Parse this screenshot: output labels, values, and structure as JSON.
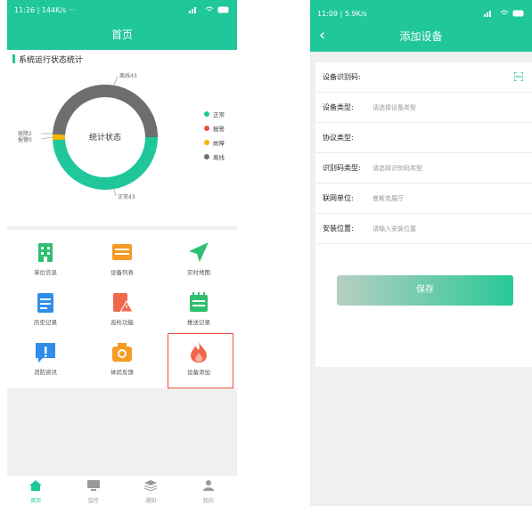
{
  "left": {
    "status": {
      "time": "11:26",
      "speed": "144K/s",
      "dots": "···"
    },
    "title": "首页",
    "stats": {
      "title": "系统运行状态统计",
      "center_label": "统计状态",
      "callouts": {
        "offline": "离线43",
        "normal": "正常43",
        "fault": "故障2",
        "alarm": "报警0"
      },
      "legend": [
        {
          "label": "正常",
          "color": "#1fc79a"
        },
        {
          "label": "报警",
          "color": "#e8523c"
        },
        {
          "label": "故障",
          "color": "#f5b800"
        },
        {
          "label": "离线",
          "color": "#6e6e6e"
        }
      ]
    },
    "grid": [
      {
        "label": "单位信息",
        "icon": "building-icon",
        "color": "#2fbf71"
      },
      {
        "label": "设备列表",
        "icon": "list-icon",
        "color": "#f59a23"
      },
      {
        "label": "实时地图",
        "icon": "send-icon",
        "color": "#2fbf71"
      },
      {
        "label": "历史记录",
        "icon": "clipboard-icon",
        "color": "#2f8fe8"
      },
      {
        "label": "巡检功能",
        "icon": "inspect-icon",
        "color": "#f0674a"
      },
      {
        "label": "推送记录",
        "icon": "calendar-icon",
        "color": "#2fbf71"
      },
      {
        "label": "消防资讯",
        "icon": "alert-message-icon",
        "color": "#2f8fe8"
      },
      {
        "label": "体验反馈",
        "icon": "camera-icon",
        "color": "#f59a23"
      },
      {
        "label": "设备添加",
        "icon": "flame-icon",
        "color": "#f0674a"
      }
    ],
    "tabs": [
      {
        "label": "首页",
        "icon": "home-icon",
        "active": true
      },
      {
        "label": "监控",
        "icon": "monitor-icon",
        "active": false
      },
      {
        "label": "通知",
        "icon": "layers-icon",
        "active": false
      },
      {
        "label": "我的",
        "icon": "user-icon",
        "active": false
      }
    ]
  },
  "right": {
    "status": {
      "time": "11:09",
      "speed": "5.9K/s"
    },
    "title": "添加设备",
    "fields": [
      {
        "label": "设备识别码:",
        "value": ""
      },
      {
        "label": "设备类型:",
        "value": "请选择设备类型"
      },
      {
        "label": "协议类型:",
        "value": ""
      },
      {
        "label": "识别码类型:",
        "value": "请选择识别码类型"
      },
      {
        "label": "联网单位:",
        "value": "曼斯克展厅"
      },
      {
        "label": "安装位置:",
        "value": "请输入安装位置"
      }
    ],
    "save_label": "保存"
  },
  "colors": {
    "accent": "#1fc79a",
    "highlight": "#e8523c"
  }
}
